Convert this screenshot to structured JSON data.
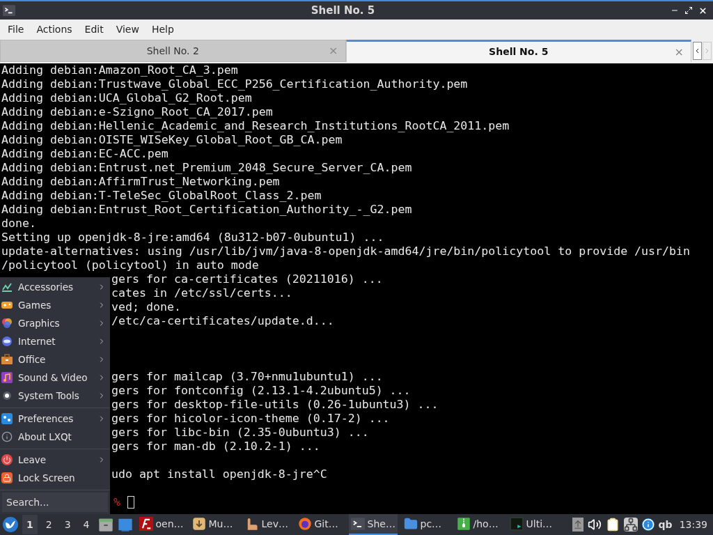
{
  "window": {
    "title": "Shell No. 5"
  },
  "menubar": [
    "File",
    "Actions",
    "Edit",
    "View",
    "Help"
  ],
  "tabs": [
    {
      "label": "Shell No. 2",
      "selected": false,
      "close": "×"
    },
    {
      "label": "Shell No. 5",
      "selected": true,
      "close": "×"
    }
  ],
  "terminal": {
    "lines": [
      {
        "kind": "full",
        "text": "Adding debian:Amazon_Root_CA_3.pem"
      },
      {
        "kind": "full",
        "text": "Adding debian:Trustwave_Global_ECC_P256_Certification_Authority.pem"
      },
      {
        "kind": "full",
        "text": "Adding debian:UCA_Global_G2_Root.pem"
      },
      {
        "kind": "full",
        "text": "Adding debian:e-Szigno_Root_CA_2017.pem"
      },
      {
        "kind": "full",
        "text": "Adding debian:Hellenic_Academic_and_Research_Institutions_RootCA_2011.pem"
      },
      {
        "kind": "full",
        "text": "Adding debian:OISTE_WISeKey_Global_Root_GB_CA.pem"
      },
      {
        "kind": "full",
        "text": "Adding debian:EC-ACC.pem"
      },
      {
        "kind": "full",
        "text": "Adding debian:Entrust.net_Premium_2048_Secure_Server_CA.pem"
      },
      {
        "kind": "full",
        "text": "Adding debian:AffirmTrust_Networking.pem"
      },
      {
        "kind": "full",
        "text": "Adding debian:T-TeleSec_GlobalRoot_Class_2.pem"
      },
      {
        "kind": "full",
        "text": "Adding debian:Entrust_Root_Certification_Authority_-_G2.pem"
      },
      {
        "kind": "full",
        "text": "done."
      },
      {
        "kind": "full",
        "text": "Setting up openjdk-8-jre:amd64 (8u312-b07-0ubuntu1) ..."
      },
      {
        "kind": "full",
        "text": "update-alternatives: using /usr/lib/jvm/java-8-openjdk-amd64/jre/bin/policytool to provide /usr/bin"
      },
      {
        "kind": "full",
        "text": "/policytool (policytool) in auto mode"
      },
      {
        "kind": "covered",
        "text": "gers for ca-certificates (20211016) ..."
      },
      {
        "kind": "covered",
        "text": "cates in /etc/ssl/certs..."
      },
      {
        "kind": "covered",
        "text": "ved; done."
      },
      {
        "kind": "covered",
        "text": "/etc/ca-certificates/update.d..."
      },
      {
        "kind": "blank"
      },
      {
        "kind": "blank"
      },
      {
        "kind": "blank"
      },
      {
        "kind": "covered",
        "text": "gers for mailcap (3.70+nmu1ubuntu1) ..."
      },
      {
        "kind": "covered",
        "text": "gers for fontconfig (2.13.1-4.2ubuntu5) ..."
      },
      {
        "kind": "covered",
        "text": "gers for desktop-file-utils (0.26-1ubuntu3) ..."
      },
      {
        "kind": "covered",
        "text": "gers for hicolor-icon-theme (0.17-2) ..."
      },
      {
        "kind": "covered",
        "text": "gers for libc-bin (2.35-0ubuntu3) ..."
      },
      {
        "kind": "covered",
        "text": "gers for man-db (2.10.2-1) ..."
      },
      {
        "kind": "blank"
      },
      {
        "kind": "covered",
        "text": "udo apt install openjdk-8-jre^C"
      },
      {
        "kind": "blank"
      },
      {
        "kind": "prompt",
        "text": "%"
      }
    ]
  },
  "app_menu": {
    "groups": [
      [
        {
          "label": "Accessories",
          "submenu": true
        },
        {
          "label": "Games",
          "submenu": true
        },
        {
          "label": "Graphics",
          "submenu": true
        },
        {
          "label": "Internet",
          "submenu": true
        },
        {
          "label": "Office",
          "submenu": true
        },
        {
          "label": "Sound & Video",
          "submenu": true
        },
        {
          "label": "System Tools",
          "submenu": true
        }
      ],
      [
        {
          "label": "Preferences",
          "submenu": true
        },
        {
          "label": "About LXQt",
          "submenu": false
        }
      ],
      [
        {
          "label": "Leave",
          "submenu": true
        },
        {
          "label": "Lock Screen",
          "submenu": false
        }
      ]
    ],
    "search": {
      "placeholder": "Search..."
    }
  },
  "taskbar": {
    "desktops": [
      {
        "label": "1",
        "selected": true
      },
      {
        "label": "2",
        "selected": false
      },
      {
        "label": "3",
        "selected": false
      },
      {
        "label": "4",
        "selected": false
      }
    ],
    "tasks": [
      {
        "label": "oen…",
        "selected": false
      },
      {
        "label": "Mu…",
        "selected": false
      },
      {
        "label": "Lev…",
        "selected": false
      },
      {
        "label": "Git…",
        "selected": false
      },
      {
        "label": "She…",
        "selected": true
      },
      {
        "label": "pc…",
        "selected": false
      },
      {
        "label": "/ho…",
        "selected": false
      },
      {
        "label": "Ulti…",
        "selected": false
      }
    ],
    "tray_text": "qb",
    "clock": "13:39"
  }
}
